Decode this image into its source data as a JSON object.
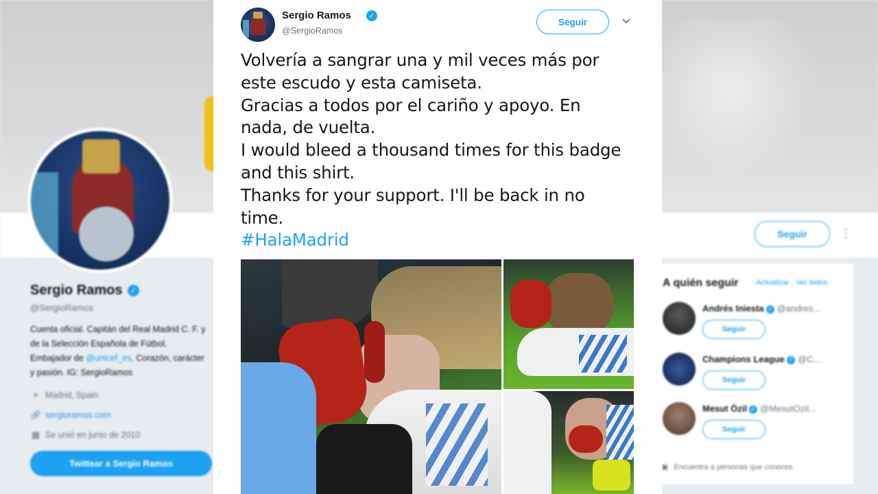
{
  "background": {
    "profile": {
      "name": "Sergio Ramos",
      "handle": "@SergioRamos",
      "bio_part1": "Cuenta oficial. Capitán del Real Madrid C. F. y de la Selección Española de Fútbol. Embajador de ",
      "bio_link": "@unicef_es",
      "bio_part2": ". Corazón, carácter y pasión. IG: SergioRamos",
      "location": "Madrid, Spain",
      "website": "sergioramos.com",
      "joined": "Se unió en junio de 2010",
      "tweet_to_label": "Twittear a Sergio Ramos",
      "follow_label": "Seguir",
      "more_icon": "⋮"
    },
    "who_to_follow": {
      "title": "A quién seguir",
      "links": "· Actualizar · Ver todos",
      "items": [
        {
          "name": "Andrés Iniesta",
          "handle": "@andres...",
          "button": "Seguir"
        },
        {
          "name": "Champions League",
          "handle": "@C...",
          "button": "Seguir"
        },
        {
          "name": "Mesut Özil",
          "handle": "@MesutOzil...",
          "button": "Seguir"
        }
      ],
      "footer": "Encuentra a personas que conoces"
    }
  },
  "tweet": {
    "author_name": "Sergio Ramos",
    "author_handle": "@SergioRamos",
    "follow_label": "Seguir",
    "caret_icon": "chevron-down-icon",
    "lines": [
      "Volvería a sangrar una y mil veces más por",
      "este escudo y esta camiseta.",
      "Gracias a todos por el cariño y apoyo. En",
      "nada, de vuelta.",
      "I would bleed a thousand times for this badge",
      "and this shirt.",
      "Thanks for your support. I'll be back in no",
      "time."
    ],
    "hashtag": "#HalaMadrid"
  },
  "colors": {
    "accent": "#1da1f2",
    "text": "#14171a",
    "secondary": "#657786"
  }
}
